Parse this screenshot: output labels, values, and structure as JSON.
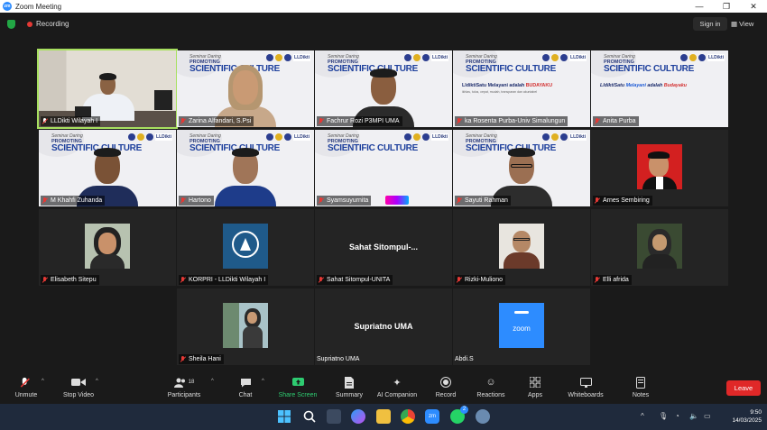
{
  "window": {
    "title": "Zoom Meeting",
    "logo_text": "zm",
    "minimize": "—",
    "maximize": "❐",
    "close": "✕"
  },
  "topbar": {
    "recording_label": "Recording",
    "sign_in_label": "Sign in",
    "view_label": "View"
  },
  "slide": {
    "seminar": "Seminar Daring",
    "promoting": "PROMOTING",
    "scientific": "SCIENTIFIC CULTURE",
    "brand": "LLDikti",
    "motto_a": "LldiktiSatu",
    "motto_b": "Melayani",
    "motto_c": "adalah",
    "motto_d": "BUDAYAKU",
    "motto2_b": "Melayani",
    "motto2_d": "Budayaku",
    "sub": "ikhlas, tulus, cepat, mudah, transparan dan akuntabel"
  },
  "participants": [
    {
      "name": "LLDikti Wilayah I",
      "type": "host"
    },
    {
      "name": "Zarina Alfandari, S.Psi",
      "type": "slide"
    },
    {
      "name": "Fachrur Rozi P3MPI UMA",
      "type": "slide"
    },
    {
      "name": "ka Rosenta Purba-Univ Simalungun",
      "type": "slide"
    },
    {
      "name": "Anita Purba",
      "type": "slide"
    },
    {
      "name": "M Khahfi Zuhanda",
      "type": "slide"
    },
    {
      "name": "Hartono",
      "type": "slide"
    },
    {
      "name": "Syamsuyurnita",
      "type": "slide"
    },
    {
      "name": "Sayuti Rahman",
      "type": "slide"
    },
    {
      "name": "Arnes Sembiring",
      "type": "avatar"
    },
    {
      "name": "Elisabeth Sitepu",
      "type": "avatar"
    },
    {
      "name": "KORPRI - LLDikti Wilayah I",
      "type": "avatar"
    },
    {
      "name": "Sahat Sitompul-UNITA",
      "display": "Sahat  Sitompul-...",
      "type": "text"
    },
    {
      "name": "Rizki-Muliono",
      "type": "avatar"
    },
    {
      "name": "Elli afrida",
      "type": "avatar"
    },
    {
      "name": "Sheila Hani",
      "type": "avatar"
    },
    {
      "name": "Supriatno UMA",
      "display": "Supriatno UMA",
      "type": "text"
    },
    {
      "name": "Abdi.S",
      "type": "avatar",
      "avatar_text": "zoom"
    }
  ],
  "toolbar": {
    "unmute": "Unmute",
    "stop_video": "Stop Video",
    "participants": "Participants",
    "participants_count": "18",
    "chat": "Chat",
    "share_screen": "Share Screen",
    "summary": "Summary",
    "ai_companion": "AI Companion",
    "record": "Record",
    "reactions": "Reactions",
    "apps": "Apps",
    "whiteboards": "Whiteboards",
    "notes": "Notes",
    "leave": "Leave"
  },
  "taskbar": {
    "time": "9:50",
    "date": "14/03/2025",
    "chat_badge": "2"
  },
  "colors": {
    "accent_active": "#a8e060",
    "leave": "#e02828",
    "share_green": "#2ecc71",
    "zoom_blue": "#2d8cff"
  }
}
